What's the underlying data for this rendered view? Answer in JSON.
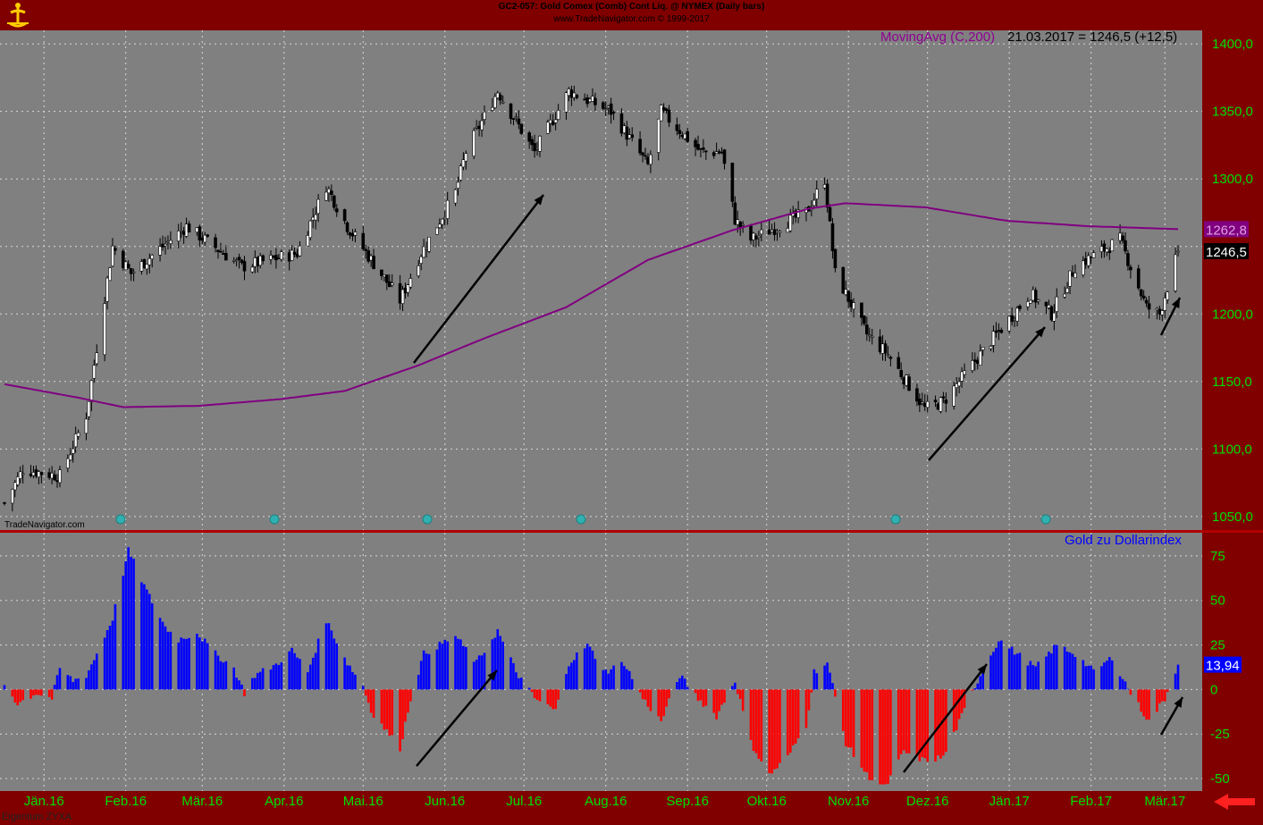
{
  "header": {
    "title": "GC2-057: Gold Comex (Comb) Cont Liq. @ NYMEX  (Daily bars)",
    "subtitle": "www.TradeNavigator.com © 1999-2017"
  },
  "footer": {
    "watermark": "TradeNavigator.com",
    "owner": "Eigentum ZYXA"
  },
  "colors": {
    "frame": "#800000",
    "panel": "#808080",
    "grid": "#d8d8d8",
    "axis_text": "#00e000",
    "ma_line": "#800080",
    "bar_up": "#0000ff",
    "bar_down": "#ff0000",
    "separator": "#b00000"
  },
  "chart_data": [
    {
      "type": "candlestick",
      "title": "",
      "legend": "MovingAvg (C,200)",
      "readout": "21.03.2017 = 1246,5 (+12,5)",
      "ylim": [
        1040,
        1410
      ],
      "y_ticks": [
        1050,
        1100,
        1150,
        1200,
        1250,
        1300,
        1350,
        1400
      ],
      "y_tick_labels": [
        "1050,0",
        "1100,0",
        "1150,0",
        "1200,0",
        "",
        "1300,0",
        "1350,0",
        "1400,0"
      ],
      "x_labels": [
        "Jän.16",
        "Feb.16",
        "Mär.16",
        "Apr.16",
        "Mai.16",
        "Jun.16",
        "Jul.16",
        "Aug.16",
        "Sep.16",
        "Okt.16",
        "Nov.16",
        "Dez.16",
        "Jän.17",
        "Feb.17",
        "Mär.17"
      ],
      "price_anchors": [
        [
          "2016-01-01",
          1060
        ],
        [
          "2016-01-08",
          1085
        ],
        [
          "2016-01-22",
          1080
        ],
        [
          "2016-02-01",
          1125
        ],
        [
          "2016-02-11",
          1250
        ],
        [
          "2016-02-18",
          1230
        ],
        [
          "2016-03-10",
          1265
        ],
        [
          "2016-03-31",
          1235
        ],
        [
          "2016-04-21",
          1245
        ],
        [
          "2016-05-02",
          1295
        ],
        [
          "2016-05-10",
          1265
        ],
        [
          "2016-05-30",
          1210
        ],
        [
          "2016-06-07",
          1245
        ],
        [
          "2016-06-20",
          1290
        ],
        [
          "2016-06-24",
          1320
        ],
        [
          "2016-07-06",
          1365
        ],
        [
          "2016-07-20",
          1320
        ],
        [
          "2016-08-02",
          1365
        ],
        [
          "2016-08-18",
          1350
        ],
        [
          "2016-09-01",
          1310
        ],
        [
          "2016-09-06",
          1350
        ],
        [
          "2016-09-21",
          1320
        ],
        [
          "2016-09-29",
          1320
        ],
        [
          "2016-10-04",
          1270
        ],
        [
          "2016-10-10",
          1255
        ],
        [
          "2016-10-31",
          1275
        ],
        [
          "2016-11-07",
          1300
        ],
        [
          "2016-11-11",
          1230
        ],
        [
          "2016-11-23",
          1185
        ],
        [
          "2016-12-01",
          1170
        ],
        [
          "2016-12-15",
          1130
        ],
        [
          "2016-12-22",
          1135
        ],
        [
          "2017-01-09",
          1180
        ],
        [
          "2017-01-24",
          1215
        ],
        [
          "2017-02-01",
          1200
        ],
        [
          "2017-02-10",
          1235
        ],
        [
          "2017-02-27",
          1255
        ],
        [
          "2017-03-09",
          1205
        ],
        [
          "2017-03-14",
          1200
        ],
        [
          "2017-03-21",
          1246.5
        ]
      ],
      "ma200_anchors": [
        [
          "2016-01-01",
          1148
        ],
        [
          "2016-01-29",
          1138
        ],
        [
          "2016-02-15",
          1131
        ],
        [
          "2016-03-15",
          1132
        ],
        [
          "2016-04-15",
          1137
        ],
        [
          "2016-05-09",
          1143
        ],
        [
          "2016-06-06",
          1162
        ],
        [
          "2016-07-01",
          1182
        ],
        [
          "2016-08-01",
          1205
        ],
        [
          "2016-09-01",
          1240
        ],
        [
          "2016-10-03",
          1262
        ],
        [
          "2016-11-01",
          1278
        ],
        [
          "2016-11-15",
          1282
        ],
        [
          "2016-12-15",
          1279
        ],
        [
          "2017-01-15",
          1269
        ],
        [
          "2017-02-15",
          1265
        ],
        [
          "2017-03-21",
          1262.8
        ]
      ],
      "last_price": {
        "value": 1246.5,
        "label": "1246,5"
      },
      "ma_last": {
        "value": 1262.8,
        "label": "1262,8"
      }
    },
    {
      "type": "bar",
      "title": "",
      "legend": "Gold zu Dollarindex",
      "ylim": [
        -57,
        88
      ],
      "y_ticks": [
        -50,
        -25,
        0,
        25,
        50,
        75
      ],
      "y_tick_labels": [
        "-50",
        "-25",
        "0",
        "25",
        "50",
        "75"
      ],
      "value_anchors": [
        [
          "2016-01-01",
          3
        ],
        [
          "2016-01-06",
          -8
        ],
        [
          "2016-01-13",
          -2
        ],
        [
          "2016-01-19",
          -5
        ],
        [
          "2016-01-22",
          12
        ],
        [
          "2016-01-27",
          5
        ],
        [
          "2016-02-01",
          8
        ],
        [
          "2016-02-05",
          20
        ],
        [
          "2016-02-11",
          40
        ],
        [
          "2016-02-17",
          78
        ],
        [
          "2016-02-24",
          55
        ],
        [
          "2016-03-02",
          35
        ],
        [
          "2016-03-07",
          28
        ],
        [
          "2016-03-14",
          32
        ],
        [
          "2016-03-21",
          20
        ],
        [
          "2016-03-28",
          12
        ],
        [
          "2016-04-01",
          -2
        ],
        [
          "2016-04-05",
          8
        ],
        [
          "2016-04-13",
          14
        ],
        [
          "2016-04-19",
          22
        ],
        [
          "2016-04-25",
          10
        ],
        [
          "2016-05-02",
          39
        ],
        [
          "2016-05-10",
          15
        ],
        [
          "2016-05-16",
          2
        ],
        [
          "2016-05-19",
          -12
        ],
        [
          "2016-05-30",
          -33
        ],
        [
          "2016-06-03",
          -5
        ],
        [
          "2016-06-08",
          20
        ],
        [
          "2016-06-20",
          30
        ],
        [
          "2016-06-28",
          15
        ],
        [
          "2016-07-06",
          33
        ],
        [
          "2016-07-13",
          10
        ],
        [
          "2016-07-20",
          -5
        ],
        [
          "2016-07-28",
          -12
        ],
        [
          "2016-08-02",
          15
        ],
        [
          "2016-08-09",
          25
        ],
        [
          "2016-08-16",
          10
        ],
        [
          "2016-08-23",
          15
        ],
        [
          "2016-08-30",
          -5
        ],
        [
          "2016-09-06",
          -18
        ],
        [
          "2016-09-13",
          8
        ],
        [
          "2016-09-20",
          -5
        ],
        [
          "2016-09-27",
          -15
        ],
        [
          "2016-10-04",
          5
        ],
        [
          "2016-10-10",
          -30
        ],
        [
          "2016-10-17",
          -48
        ],
        [
          "2016-10-24",
          -38
        ],
        [
          "2016-10-31",
          -20
        ],
        [
          "2016-11-03",
          10
        ],
        [
          "2016-11-08",
          15
        ],
        [
          "2016-11-15",
          -30
        ],
        [
          "2016-11-23",
          -48
        ],
        [
          "2016-11-30",
          -55
        ],
        [
          "2016-12-07",
          -35
        ],
        [
          "2016-12-15",
          -40
        ],
        [
          "2016-12-22",
          -38
        ],
        [
          "2016-12-29",
          -15
        ],
        [
          "2017-01-04",
          5
        ],
        [
          "2017-01-12",
          28
        ],
        [
          "2017-01-19",
          20
        ],
        [
          "2017-01-26",
          12
        ],
        [
          "2017-02-03",
          25
        ],
        [
          "2017-02-10",
          20
        ],
        [
          "2017-02-17",
          10
        ],
        [
          "2017-02-24",
          18
        ],
        [
          "2017-03-03",
          -2
        ],
        [
          "2017-03-10",
          -18
        ],
        [
          "2017-03-16",
          -5
        ],
        [
          "2017-03-21",
          13.94
        ]
      ],
      "last_value": {
        "value": 13.94,
        "label": "13,94"
      }
    }
  ]
}
